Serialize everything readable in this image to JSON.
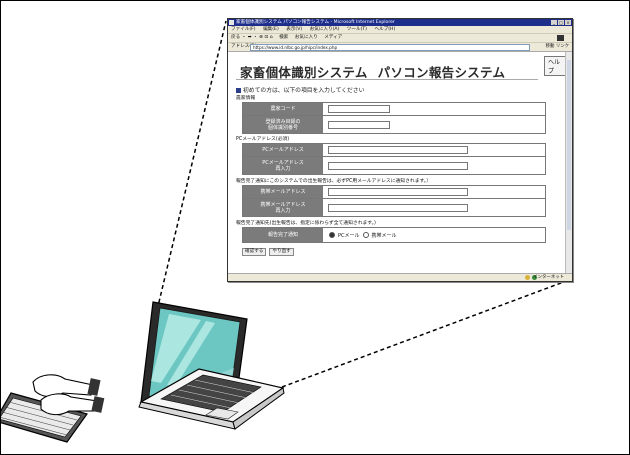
{
  "browser": {
    "title": "家畜個体識別システム パソコン報告システム - Microsoft Internet Explorer",
    "menu": [
      "ファイル(F)",
      "編集(E)",
      "表示(V)",
      "お気に入り(A)",
      "ツール(T)",
      "ヘルプ(H)"
    ],
    "toolbar": [
      "戻る ・ ➡ ・ ⊗ ⊡ ⌂",
      "検索",
      "お気に入り",
      "メディア"
    ],
    "address_label": "アドレス(D)",
    "address": "https://www.id.nlbc.go.jp/hipc/index.php",
    "go_label": "移動",
    "link_label": "リンク",
    "status_zone": "インターネット"
  },
  "page": {
    "help_label": "ヘルプ",
    "title_main": "家畜個体識別システム",
    "title_sub": "パソコン報告システム",
    "intro": "初めての方は、以下の項目を入力してください",
    "section_basic": "農家情報",
    "farm_code_label": "農家コード",
    "registered_id_label_1": "登録済み目録の",
    "registered_id_label_2": "個体識別番号",
    "section_pc_mail": "PCメールアドレス(必須)",
    "pc_mail_label": "PCメールアドレス",
    "pc_mail_confirm_label_1": "PCメールアドレス",
    "pc_mail_confirm_label_2": "再入力",
    "section_mobile": "報告完了通知にこのシステムでの出生報告は、必ずPC用メールアドレスに通知されます。）",
    "mobile_mail_label": "携帯メールアドレス",
    "mobile_mail_confirm_label_1": "携帯メールアドレス",
    "mobile_mail_confirm_label_2": "再入力",
    "section_notice": "報告完了通知先(出生報告は、指定に係わらず全て通知されます。)",
    "notice_label": "報告完了通知",
    "radio_pc": "PCメール",
    "radio_mobile": "携帯メール",
    "confirm_button": "確認する",
    "reset_button": "やり直す"
  }
}
